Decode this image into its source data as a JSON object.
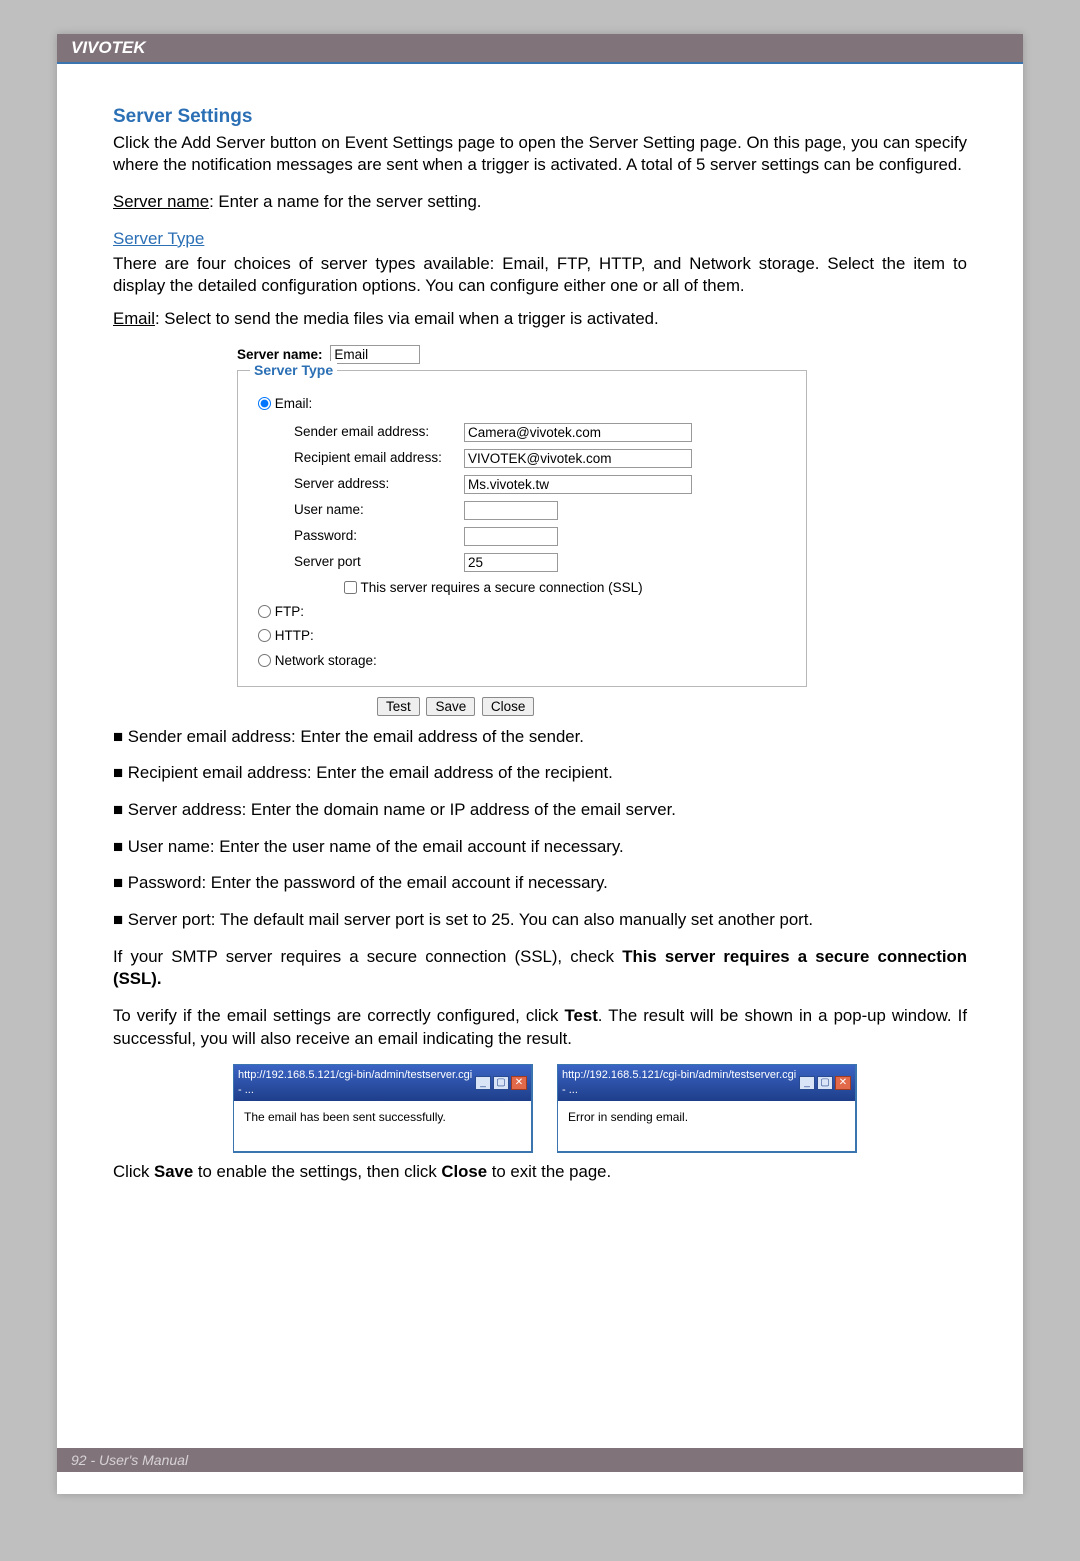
{
  "header": {
    "brand": "VIVOTEK"
  },
  "footer": {
    "text": "92 - User's Manual"
  },
  "section": {
    "title": "Server Settings",
    "intro": "Click the Add Server button on Event Settings page to open the Server Setting page. On this page, you can specify where the notification messages are sent when a trigger is activated. A total of 5 server settings can be configured.",
    "server_name_label": "Server name",
    "server_name_desc": ": Enter a name for the server setting.",
    "type_title": "Server Type",
    "type_intro": "There are four choices of server types available: Email, FTP, HTTP, and Network storage. Select the item to display the detailed configuration options. You can configure either one or all of them.",
    "email_label": "Email",
    "email_desc": ": Select to send the media files via email when a trigger is activated."
  },
  "form": {
    "server_name_label": "Server name:",
    "server_name_value": "Email",
    "legend": "Server Type",
    "radios": {
      "email": "Email:",
      "ftp": "FTP:",
      "http": "HTTP:",
      "ns": "Network storage:"
    },
    "fields": {
      "sender_label": "Sender email address:",
      "sender_value": "Camera@vivotek.com",
      "recipient_label": "Recipient email address:",
      "recipient_value": "VIVOTEK@vivotek.com",
      "server_addr_label": "Server address:",
      "server_addr_value": "Ms.vivotek.tw",
      "user_label": "User name:",
      "user_value": "",
      "pwd_label": "Password:",
      "pwd_value": "",
      "port_label": "Server port",
      "port_value": "25",
      "ssl_label": "This server requires a secure connection (SSL)"
    },
    "buttons": {
      "test": "Test",
      "save": "Save",
      "close": "Close"
    }
  },
  "bullets": {
    "b1": "■ Sender email address: Enter the email address of the sender.",
    "b2": "■ Recipient email address: Enter the email address of the recipient.",
    "b3": "■ Server address: Enter the domain name or IP address of the email server.",
    "b4": "■ User name: Enter the user name of the email account if necessary.",
    "b5": "■ Password: Enter the password of the email account if necessary.",
    "b6": "■ Server port: The default mail server port is set to 25. You can also manually set another port."
  },
  "ssl_note_pre": "If your SMTP server requires a secure connection (SSL), check ",
  "ssl_note_bold": "This server requires a secure connection (SSL).",
  "test_note_pre": "To verify if the email settings are correctly configured, click ",
  "test_note_bold": "Test",
  "test_note_post": ". The result will be shown in a pop-up window. If successful, you will also receive an email indicating the result.",
  "popups": {
    "title": "http://192.168.5.121/cgi-bin/admin/testserver.cgi - ...",
    "success": "The email has been sent successfully.",
    "error": "Error in sending email."
  },
  "closing_pre": "Click ",
  "closing_save": "Save",
  "closing_mid": " to enable the settings, then click ",
  "closing_close": "Close",
  "closing_post": " to exit the page."
}
